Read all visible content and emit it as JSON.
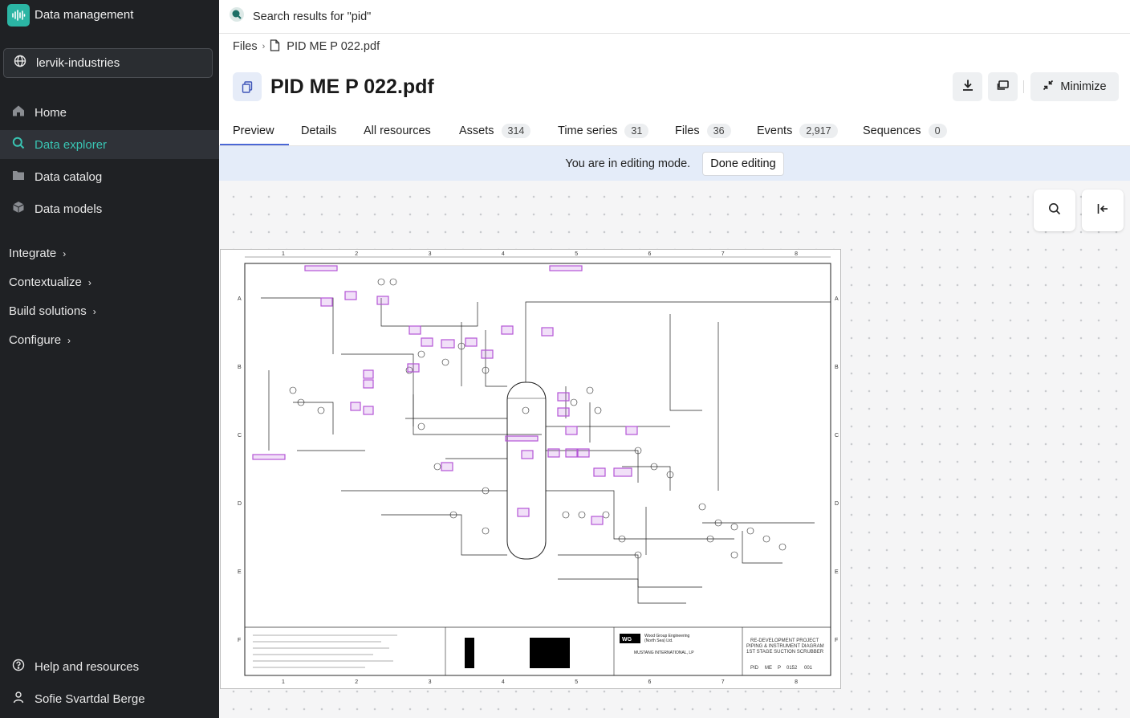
{
  "app": {
    "title": "Data management"
  },
  "org": {
    "name": "lervik-industries"
  },
  "nav": {
    "items": [
      {
        "label": "Home",
        "icon": "home-icon"
      },
      {
        "label": "Data explorer",
        "icon": "search-icon",
        "active": true
      },
      {
        "label": "Data catalog",
        "icon": "folder-icon"
      },
      {
        "label": "Data models",
        "icon": "cube-icon"
      }
    ],
    "sections": [
      "Integrate",
      "Contextualize",
      "Build solutions",
      "Configure"
    ]
  },
  "footer": {
    "help": "Help and resources",
    "user": "Sofie Svartdal Berge"
  },
  "search": {
    "query": "Search results for \"pid\""
  },
  "breadcrumb": {
    "root": "Files",
    "current": "PID ME P 022.pdf"
  },
  "file": {
    "title": "PID ME P 022.pdf"
  },
  "toolbar": {
    "minimize_label": "Minimize"
  },
  "tabs": [
    {
      "label": "Preview"
    },
    {
      "label": "Details"
    },
    {
      "label": "All resources"
    },
    {
      "label": "Assets",
      "count": "314"
    },
    {
      "label": "Time series",
      "count": "31"
    },
    {
      "label": "Files",
      "count": "36"
    },
    {
      "label": "Events",
      "count": "2,917"
    },
    {
      "label": "Sequences",
      "count": "0"
    }
  ],
  "banner": {
    "text": "You are in editing mode.",
    "done_label": "Done editing"
  },
  "colors": {
    "sidebar_bg": "#1f2124",
    "accent": "#39c4b3",
    "tab_underline": "#4a67d6",
    "banner_bg": "#e4ecf9",
    "annotation": "#b455d6"
  },
  "drawing": {
    "tags": [
      "PID",
      "ME",
      "P",
      "0152",
      "001"
    ],
    "title_block": [
      "RE-DEVELOPMENT PROJECT",
      "PIPING & INSTRUMENT DIAGRAM",
      "1ST STAGE SUCTION SCRUBBER"
    ],
    "company": [
      "Wood Group Engineering",
      "(North Sea) Ltd."
    ],
    "contractor": "MUSTANG INTERNATIONAL, LP",
    "grid_cols": [
      "1",
      "2",
      "3",
      "4",
      "5",
      "6",
      "7",
      "8"
    ],
    "grid_rows": [
      "A",
      "B",
      "C",
      "D",
      "E",
      "F"
    ]
  }
}
